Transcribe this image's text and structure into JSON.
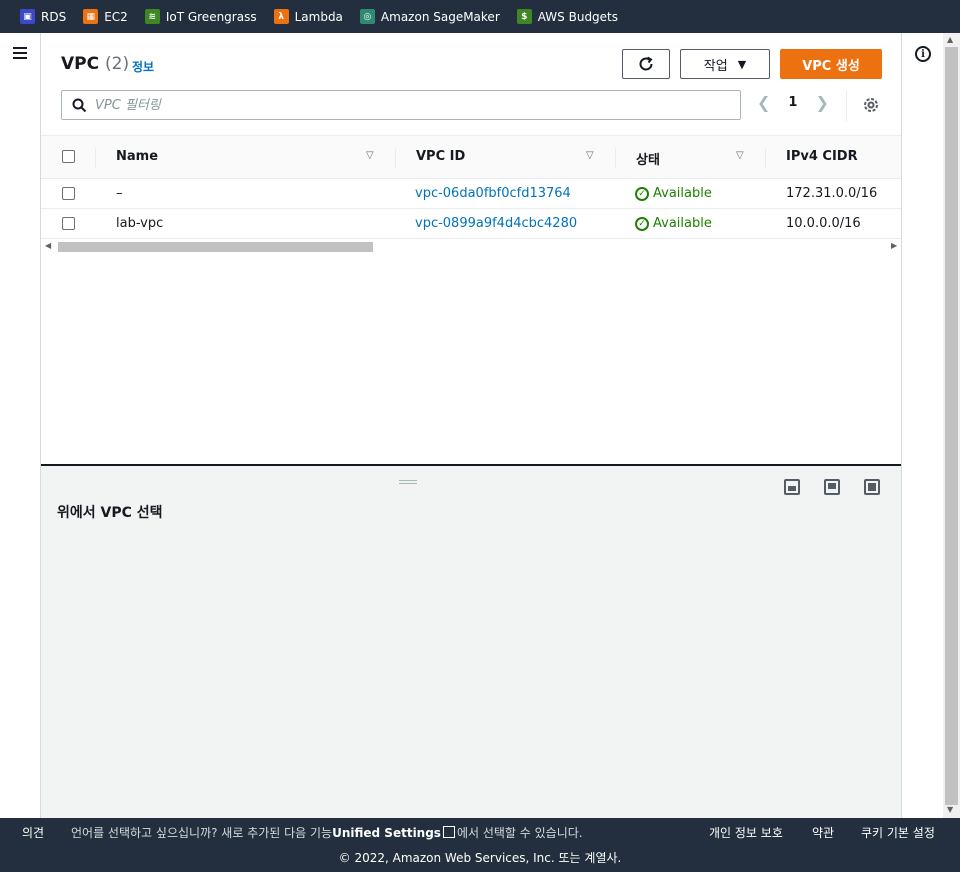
{
  "favorites": [
    {
      "label": "RDS",
      "icon": "rds-icon",
      "color": "#3b48cc"
    },
    {
      "label": "EC2",
      "icon": "ec2-icon",
      "color": "#ec7211"
    },
    {
      "label": "IoT Greengrass",
      "icon": "iot-greengrass-icon",
      "color": "#3f8624"
    },
    {
      "label": "Lambda",
      "icon": "lambda-icon",
      "color": "#ec7211"
    },
    {
      "label": "Amazon SageMaker",
      "icon": "sagemaker-icon",
      "color": "#2e8b72"
    },
    {
      "label": "AWS Budgets",
      "icon": "budgets-icon",
      "color": "#3f8624"
    }
  ],
  "header": {
    "title": "VPC",
    "count": "(2)",
    "info_link": "정보",
    "actions_label": "작업",
    "create_label": "VPC 생성"
  },
  "search": {
    "placeholder": "VPC 필터링"
  },
  "pagination": {
    "page": "1"
  },
  "table": {
    "columns": [
      "Name",
      "VPC ID",
      "상태",
      "IPv4 CIDR"
    ],
    "rows": [
      {
        "name": "–",
        "vpc_id": "vpc-06da0fbf0cfd13764",
        "status": "Available",
        "cidr": "172.31.0.0/16"
      },
      {
        "name": "lab-vpc",
        "vpc_id": "vpc-0899a9f4d4cbc4280",
        "status": "Available",
        "cidr": "10.0.0.0/16"
      }
    ]
  },
  "split_panel": {
    "title": "위에서 VPC 선택"
  },
  "footer": {
    "feedback": "의견",
    "lang_prefix": "언어를 선택하고 싶으십니까? 새로 추가된 다음 기능",
    "lang_link": "Unified Settings",
    "lang_suffix": "에서 선택할 수 있습니다.",
    "privacy": "개인 정보 보호",
    "terms": "약관",
    "cookie": "쿠키 기본 설정",
    "copyright": "© 2022, Amazon Web Services, Inc. 또는 계열사."
  },
  "colors": {
    "accent": "#ec7211",
    "link": "#0073bb",
    "success": "#1d8102",
    "nav": "#232f3e"
  }
}
